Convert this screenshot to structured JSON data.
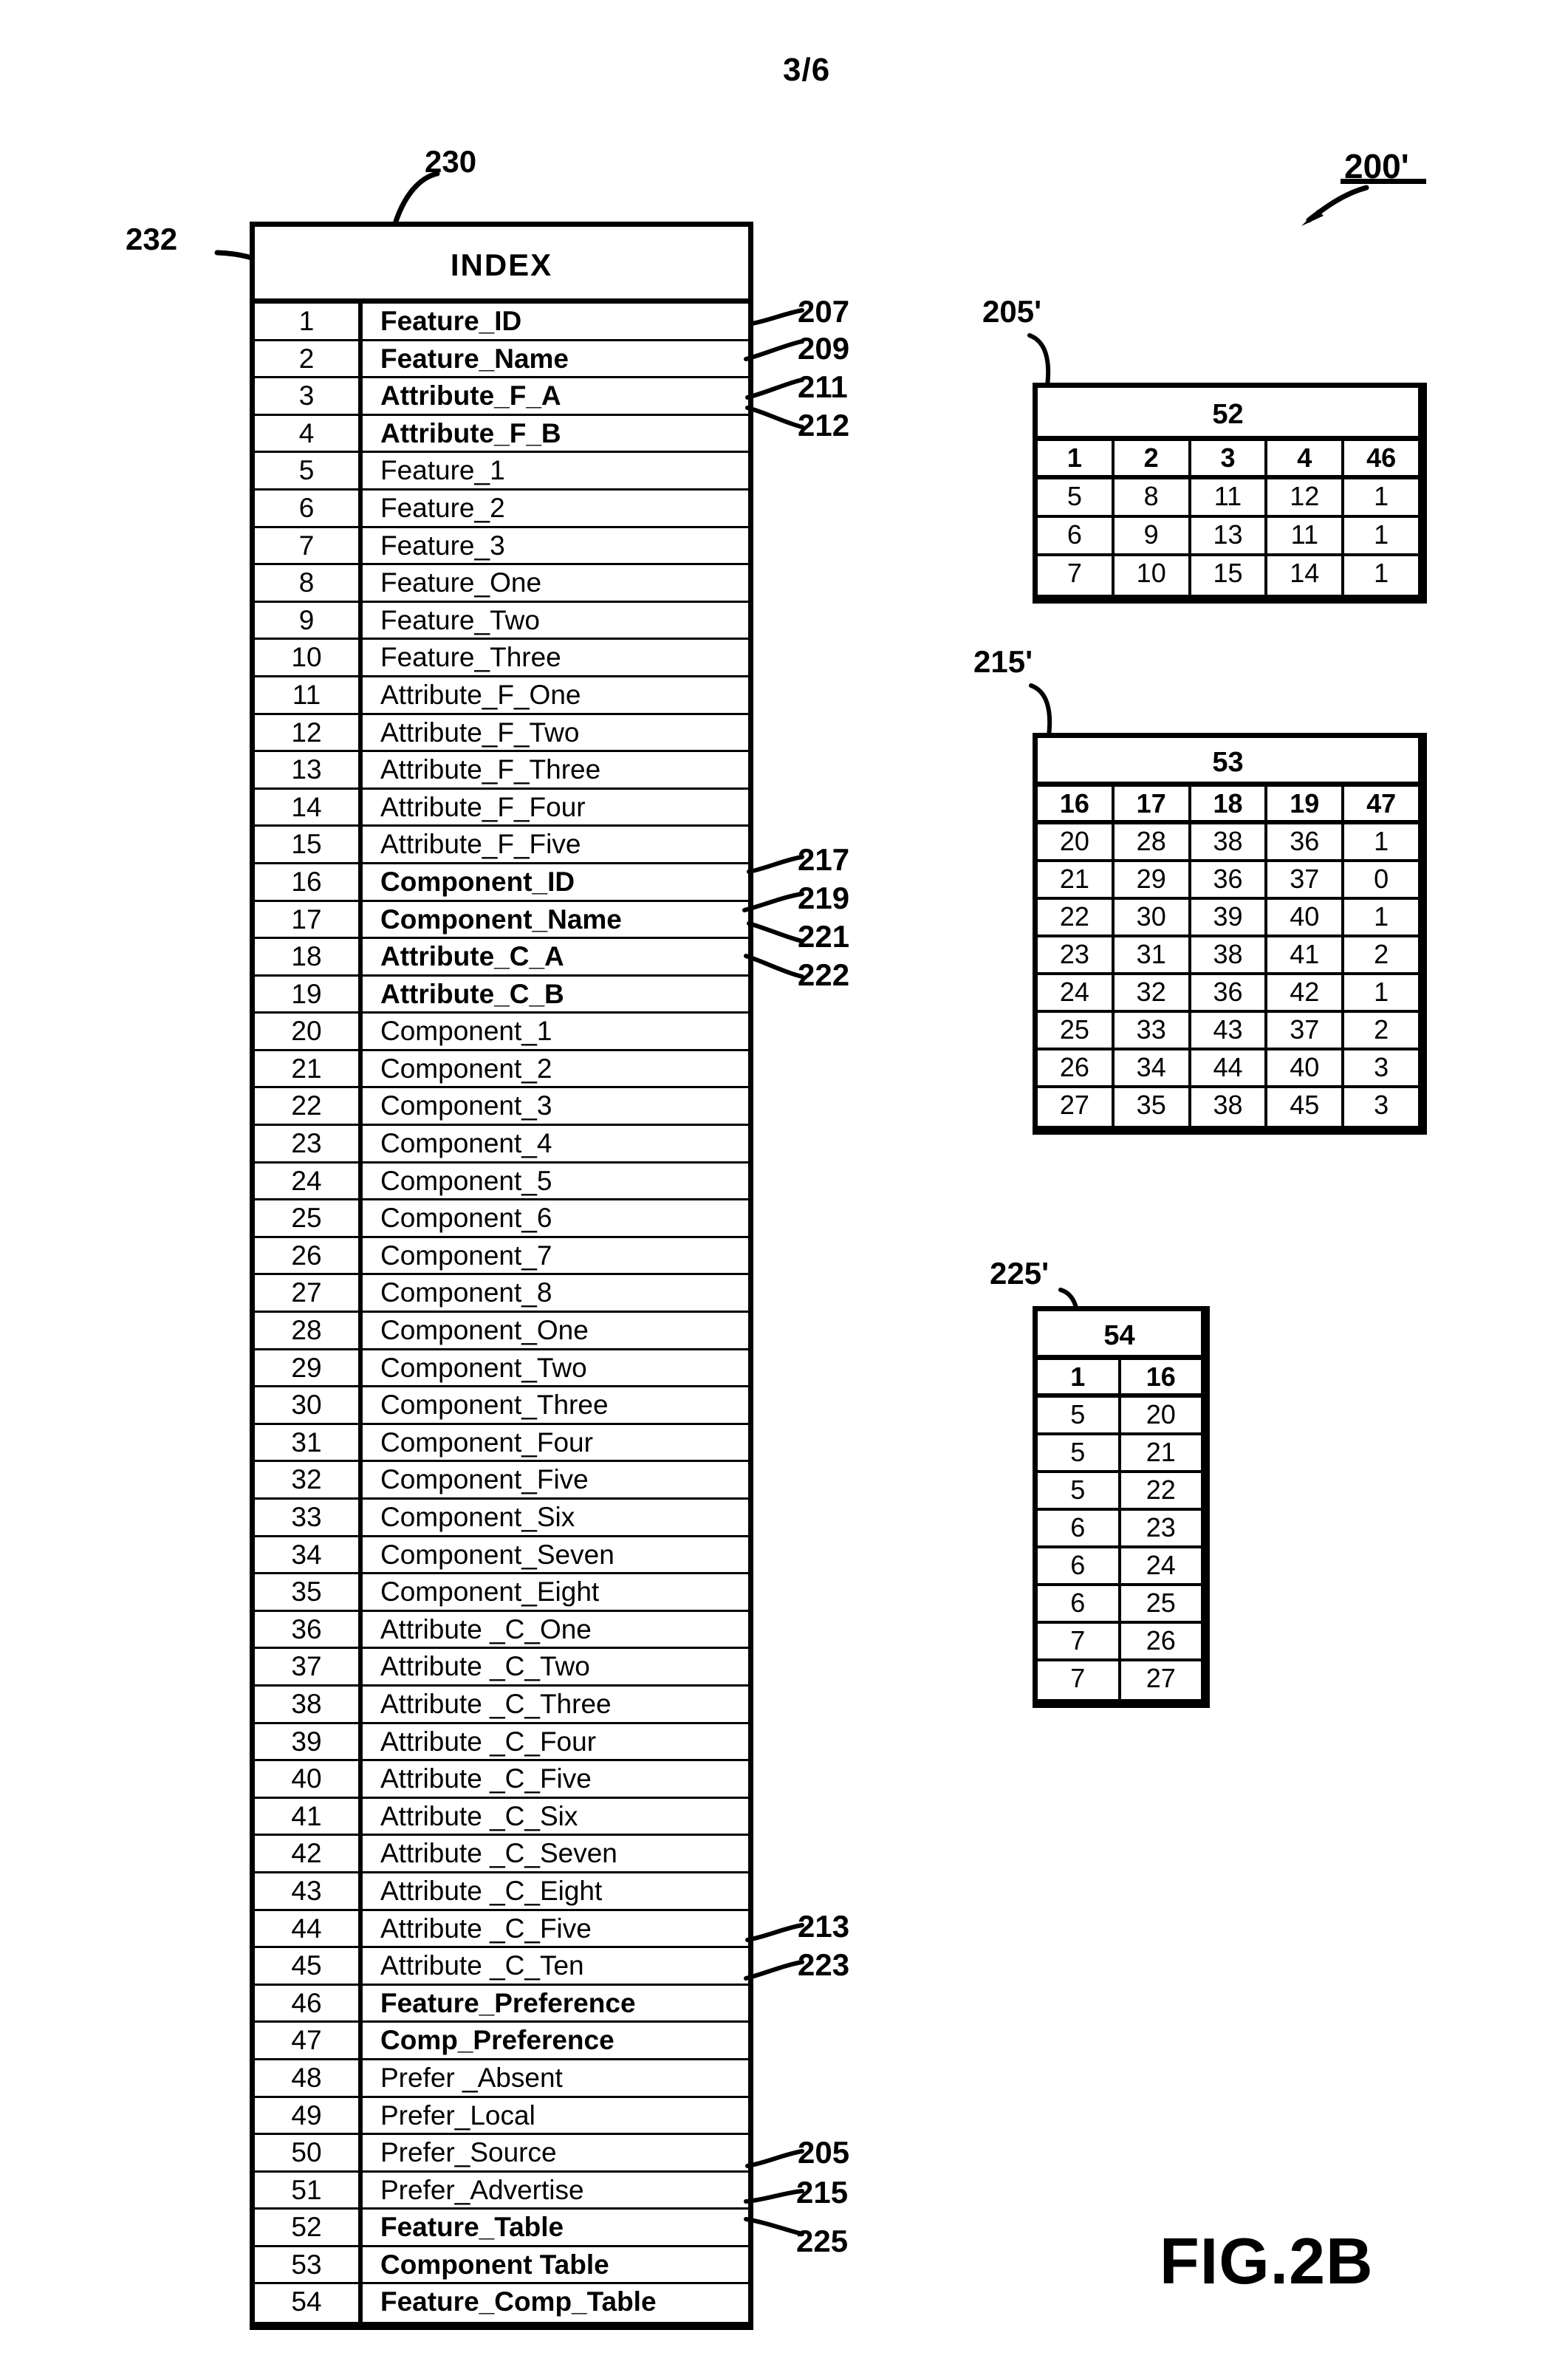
{
  "page": {
    "sheet_number": "3/6",
    "figure_label": "FIG.2B",
    "overall_ref": "200'"
  },
  "index_table": {
    "ref_box": "230",
    "ref_first_row": "232",
    "title": "INDEX",
    "rows": [
      {
        "num": "1",
        "label": "Feature_ID",
        "bold": true,
        "ref": "207"
      },
      {
        "num": "2",
        "label": "Feature_Name",
        "bold": true,
        "ref": "209"
      },
      {
        "num": "3",
        "label": "Attribute_F_A",
        "bold": true,
        "ref": "211"
      },
      {
        "num": "4",
        "label": "Attribute_F_B",
        "bold": true,
        "ref": "212"
      },
      {
        "num": "5",
        "label": "Feature_1",
        "bold": false,
        "ref": ""
      },
      {
        "num": "6",
        "label": "Feature_2",
        "bold": false,
        "ref": ""
      },
      {
        "num": "7",
        "label": "Feature_3",
        "bold": false,
        "ref": ""
      },
      {
        "num": "8",
        "label": "Feature_One",
        "bold": false,
        "ref": ""
      },
      {
        "num": "9",
        "label": "Feature_Two",
        "bold": false,
        "ref": ""
      },
      {
        "num": "10",
        "label": "Feature_Three",
        "bold": false,
        "ref": ""
      },
      {
        "num": "11",
        "label": "Attribute_F_One",
        "bold": false,
        "ref": ""
      },
      {
        "num": "12",
        "label": "Attribute_F_Two",
        "bold": false,
        "ref": ""
      },
      {
        "num": "13",
        "label": "Attribute_F_Three",
        "bold": false,
        "ref": ""
      },
      {
        "num": "14",
        "label": "Attribute_F_Four",
        "bold": false,
        "ref": ""
      },
      {
        "num": "15",
        "label": "Attribute_F_Five",
        "bold": false,
        "ref": ""
      },
      {
        "num": "16",
        "label": "Component_ID",
        "bold": true,
        "ref": "217"
      },
      {
        "num": "17",
        "label": "Component_Name",
        "bold": true,
        "ref": "219"
      },
      {
        "num": "18",
        "label": "Attribute_C_A",
        "bold": true,
        "ref": "221"
      },
      {
        "num": "19",
        "label": "Attribute_C_B",
        "bold": true,
        "ref": "222"
      },
      {
        "num": "20",
        "label": "Component_1",
        "bold": false,
        "ref": ""
      },
      {
        "num": "21",
        "label": "Component_2",
        "bold": false,
        "ref": ""
      },
      {
        "num": "22",
        "label": "Component_3",
        "bold": false,
        "ref": ""
      },
      {
        "num": "23",
        "label": "Component_4",
        "bold": false,
        "ref": ""
      },
      {
        "num": "24",
        "label": "Component_5",
        "bold": false,
        "ref": ""
      },
      {
        "num": "25",
        "label": "Component_6",
        "bold": false,
        "ref": ""
      },
      {
        "num": "26",
        "label": "Component_7",
        "bold": false,
        "ref": ""
      },
      {
        "num": "27",
        "label": "Component_8",
        "bold": false,
        "ref": ""
      },
      {
        "num": "28",
        "label": "Component_One",
        "bold": false,
        "ref": ""
      },
      {
        "num": "29",
        "label": "Component_Two",
        "bold": false,
        "ref": ""
      },
      {
        "num": "30",
        "label": "Component_Three",
        "bold": false,
        "ref": ""
      },
      {
        "num": "31",
        "label": "Component_Four",
        "bold": false,
        "ref": ""
      },
      {
        "num": "32",
        "label": "Component_Five",
        "bold": false,
        "ref": ""
      },
      {
        "num": "33",
        "label": "Component_Six",
        "bold": false,
        "ref": ""
      },
      {
        "num": "34",
        "label": "Component_Seven",
        "bold": false,
        "ref": ""
      },
      {
        "num": "35",
        "label": "Component_Eight",
        "bold": false,
        "ref": ""
      },
      {
        "num": "36",
        "label": "Attribute _C_One",
        "bold": false,
        "ref": ""
      },
      {
        "num": "37",
        "label": "Attribute _C_Two",
        "bold": false,
        "ref": ""
      },
      {
        "num": "38",
        "label": "Attribute _C_Three",
        "bold": false,
        "ref": ""
      },
      {
        "num": "39",
        "label": "Attribute _C_Four",
        "bold": false,
        "ref": ""
      },
      {
        "num": "40",
        "label": "Attribute _C_Five",
        "bold": false,
        "ref": ""
      },
      {
        "num": "41",
        "label": "Attribute _C_Six",
        "bold": false,
        "ref": ""
      },
      {
        "num": "42",
        "label": "Attribute _C_Seven",
        "bold": false,
        "ref": ""
      },
      {
        "num": "43",
        "label": "Attribute _C_Eight",
        "bold": false,
        "ref": ""
      },
      {
        "num": "44",
        "label": "Attribute _C_Five",
        "bold": false,
        "ref": ""
      },
      {
        "num": "45",
        "label": "Attribute _C_Ten",
        "bold": false,
        "ref": ""
      },
      {
        "num": "46",
        "label": "Feature_Preference",
        "bold": true,
        "ref": "213"
      },
      {
        "num": "47",
        "label": "Comp_Preference",
        "bold": true,
        "ref": "223"
      },
      {
        "num": "48",
        "label": "Prefer _Absent",
        "bold": false,
        "ref": ""
      },
      {
        "num": "49",
        "label": "Prefer_Local",
        "bold": false,
        "ref": ""
      },
      {
        "num": "50",
        "label": "Prefer_Source",
        "bold": false,
        "ref": ""
      },
      {
        "num": "51",
        "label": "Prefer_Advertise",
        "bold": false,
        "ref": ""
      },
      {
        "num": "52",
        "label": "Feature_Table",
        "bold": true,
        "ref": "205"
      },
      {
        "num": "53",
        "label": "Component Table",
        "bold": true,
        "ref": "215"
      },
      {
        "num": "54",
        "label": "Feature_Comp_Table",
        "bold": true,
        "ref": "225"
      }
    ]
  },
  "feature_table": {
    "ref": "205'",
    "caption": "52",
    "header": [
      "1",
      "2",
      "3",
      "4",
      "46"
    ],
    "rows": [
      [
        "5",
        "8",
        "11",
        "12",
        "1"
      ],
      [
        "6",
        "9",
        "13",
        "11",
        "1"
      ],
      [
        "7",
        "10",
        "15",
        "14",
        "1"
      ]
    ]
  },
  "component_table": {
    "ref": "215'",
    "caption": "53",
    "header": [
      "16",
      "17",
      "18",
      "19",
      "47"
    ],
    "rows": [
      [
        "20",
        "28",
        "38",
        "36",
        "1"
      ],
      [
        "21",
        "29",
        "36",
        "37",
        "0"
      ],
      [
        "22",
        "30",
        "39",
        "40",
        "1"
      ],
      [
        "23",
        "31",
        "38",
        "41",
        "2"
      ],
      [
        "24",
        "32",
        "36",
        "42",
        "1"
      ],
      [
        "25",
        "33",
        "43",
        "37",
        "2"
      ],
      [
        "26",
        "34",
        "44",
        "40",
        "3"
      ],
      [
        "27",
        "35",
        "38",
        "45",
        "3"
      ]
    ]
  },
  "feature_comp_table": {
    "ref": "225'",
    "caption": "54",
    "header": [
      "1",
      "16"
    ],
    "rows": [
      [
        "5",
        "20"
      ],
      [
        "5",
        "21"
      ],
      [
        "5",
        "22"
      ],
      [
        "6",
        "23"
      ],
      [
        "6",
        "24"
      ],
      [
        "6",
        "25"
      ],
      [
        "7",
        "26"
      ],
      [
        "7",
        "27"
      ]
    ]
  }
}
